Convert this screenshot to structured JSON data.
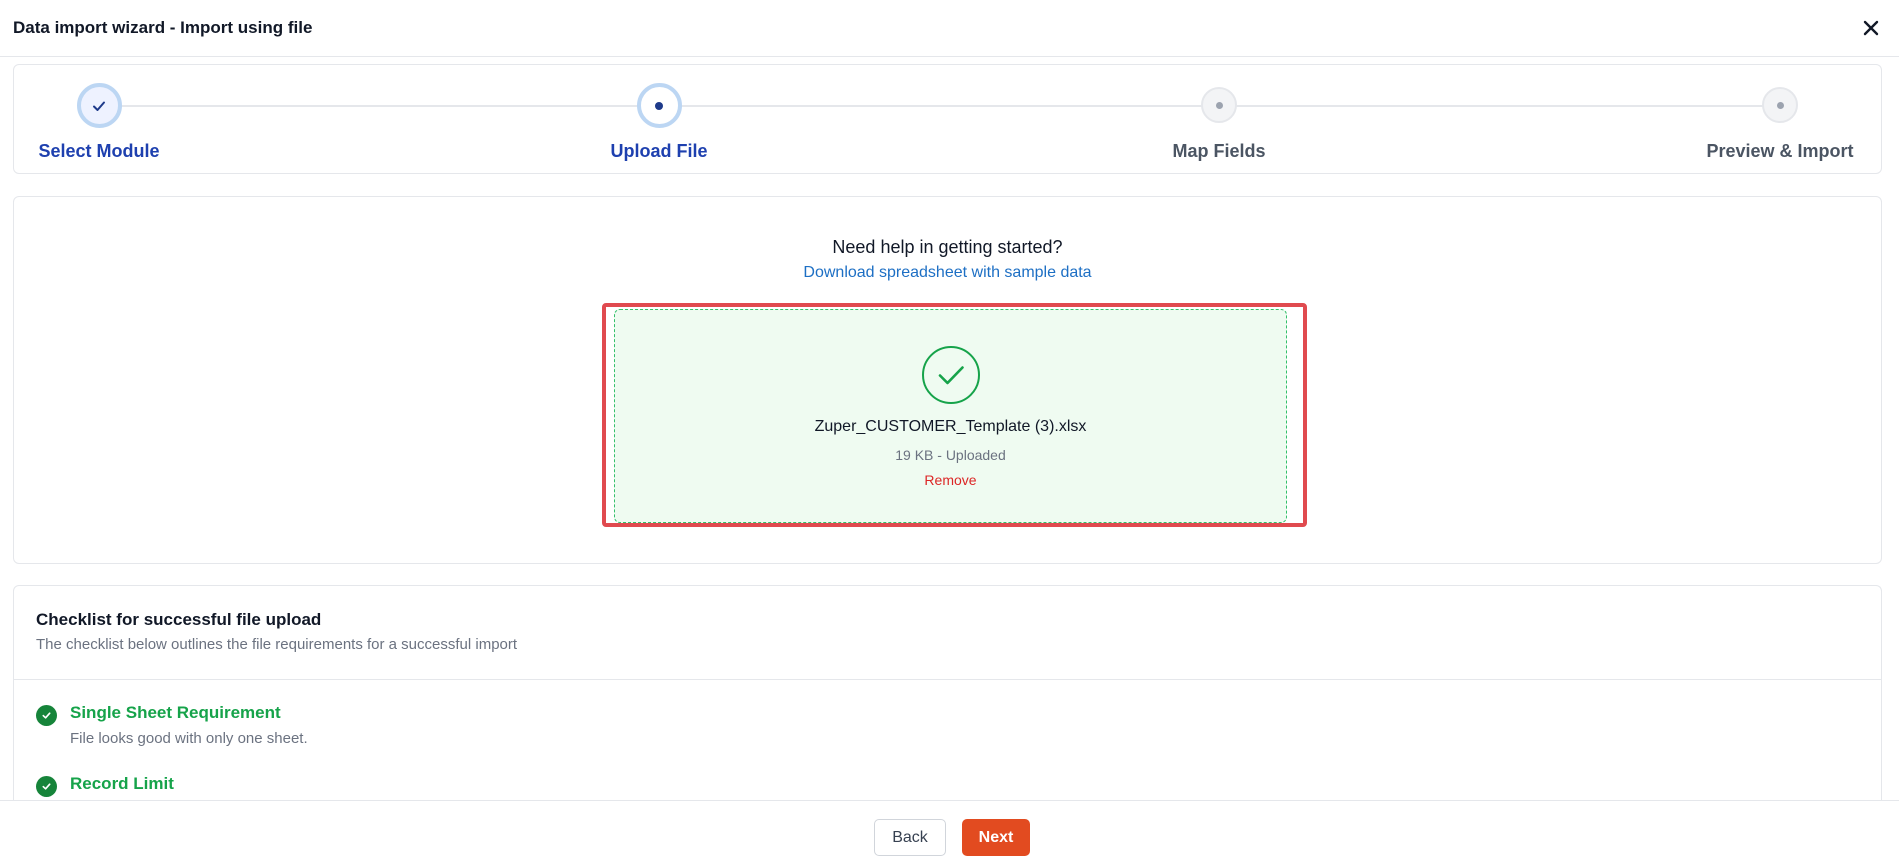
{
  "header": {
    "title": "Data import wizard - Import using file",
    "close_icon": "close-icon"
  },
  "stepper": {
    "steps": [
      {
        "label": "Select Module",
        "state": "completed"
      },
      {
        "label": "Upload File",
        "state": "active"
      },
      {
        "label": "Map Fields",
        "state": "pending"
      },
      {
        "label": "Preview & Import",
        "state": "pending"
      }
    ]
  },
  "upload": {
    "help_title": "Need help in getting started?",
    "help_link": "Download spreadsheet with sample data",
    "file_name": "Zuper_CUSTOMER_Template (3).xlsx",
    "file_meta": "19 KB - Uploaded",
    "remove_label": "Remove"
  },
  "checklist": {
    "title": "Checklist for successful file upload",
    "subtitle": "The checklist below outlines the file requirements for a successful import",
    "items": [
      {
        "title": "Single Sheet Requirement",
        "desc": "File looks good with only one sheet."
      },
      {
        "title": "Record Limit",
        "desc": ""
      }
    ]
  },
  "footer": {
    "back_label": "Back",
    "next_label": "Next"
  },
  "colors": {
    "accent_blue": "#1e40af",
    "success_green": "#16a34a",
    "next_button": "#e24b20",
    "highlight_red": "#e04a4f"
  }
}
